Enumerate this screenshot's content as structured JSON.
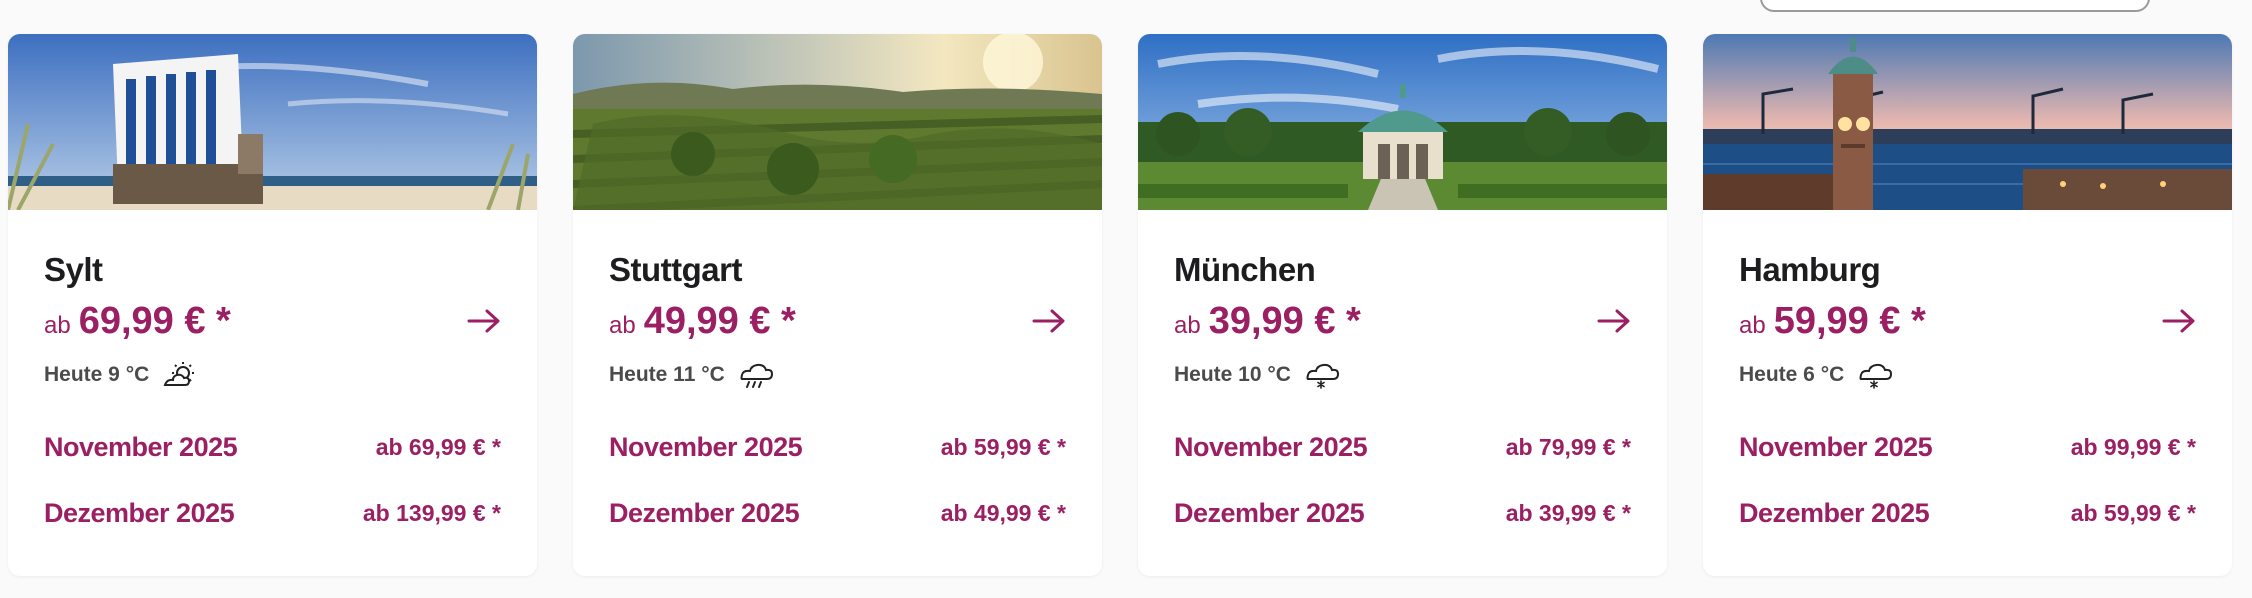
{
  "colors": {
    "accent": "#9b2063",
    "heading": "#1d1d1f",
    "weather_text": "#4b4b4b",
    "background": "#fafafa"
  },
  "cards": [
    {
      "city": "Sylt",
      "price_prefix": "ab",
      "price": "69,99 € *",
      "weather": "Heute 9 °C",
      "weather_icon": "partly-sunny-icon",
      "months": [
        {
          "label": "November 2025",
          "price": "ab 69,99 € *"
        },
        {
          "label": "Dezember 2025",
          "price": "ab 139,99 € *"
        }
      ]
    },
    {
      "city": "Stuttgart",
      "price_prefix": "ab",
      "price": "49,99 € *",
      "weather": "Heute 11 °C",
      "weather_icon": "rain-cloud-icon",
      "months": [
        {
          "label": "November 2025",
          "price": "ab 59,99 € *"
        },
        {
          "label": "Dezember 2025",
          "price": "ab 49,99 € *"
        }
      ]
    },
    {
      "city": "München",
      "price_prefix": "ab",
      "price": "39,99 € *",
      "weather": "Heute 10 °C",
      "weather_icon": "snow-cloud-icon",
      "months": [
        {
          "label": "November 2025",
          "price": "ab 79,99 € *"
        },
        {
          "label": "Dezember 2025",
          "price": "ab 39,99 € *"
        }
      ]
    },
    {
      "city": "Hamburg",
      "price_prefix": "ab",
      "price": "59,99 € *",
      "weather": "Heute 6 °C",
      "weather_icon": "snow-cloud-icon",
      "months": [
        {
          "label": "November 2025",
          "price": "ab 99,99 € *"
        },
        {
          "label": "Dezember 2025",
          "price": "ab 59,99 € *"
        }
      ]
    }
  ]
}
